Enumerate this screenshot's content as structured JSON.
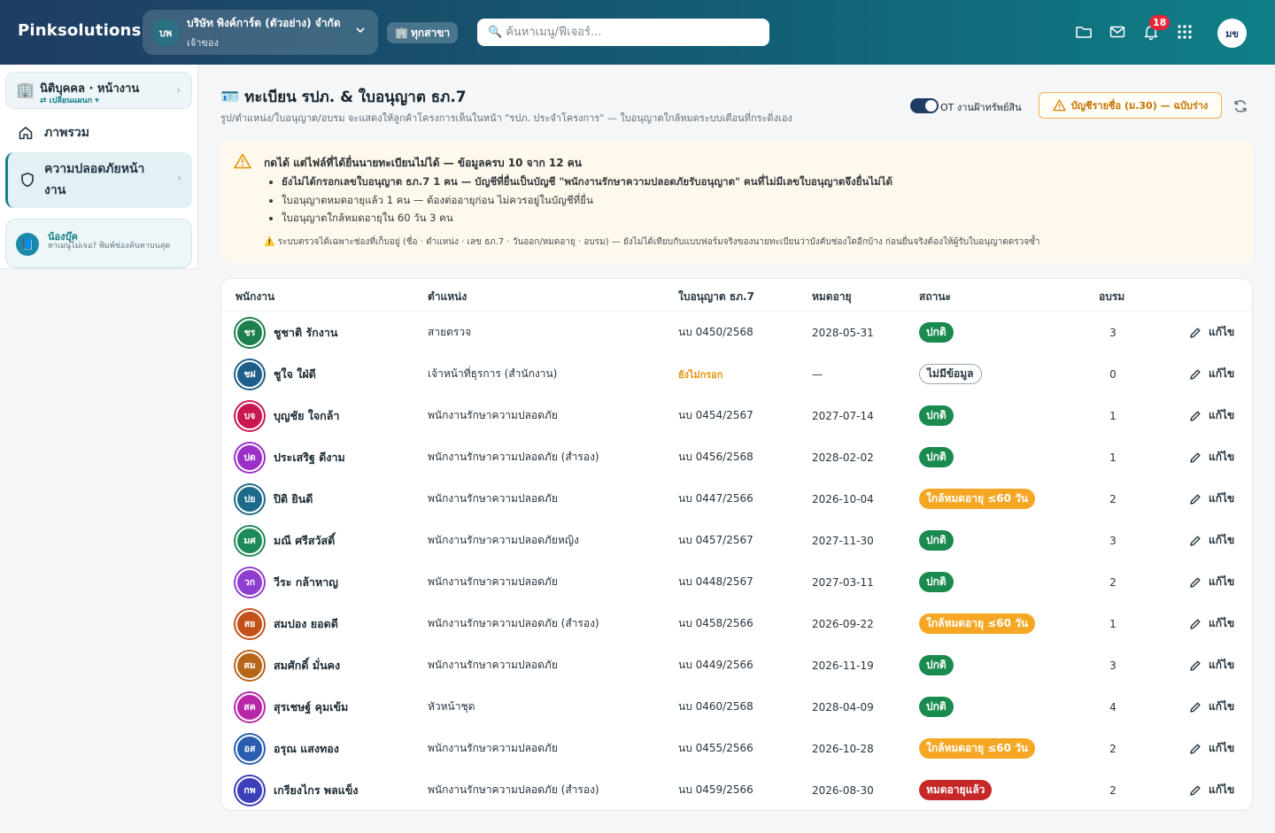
{
  "topbar": {
    "brand": "Pinksolutions",
    "company_initials": "บพ",
    "company_name": "บริษัท พิงค์การ์ด (ตัวอย่าง) จำกัด",
    "company_role": "เจ้าของ",
    "branch_label": "ทุกสาขา",
    "search_placeholder": "ค้นหาเมนู/ฟีเจอร์...",
    "notification_count": "18",
    "user_initials": "มข"
  },
  "sidebar": {
    "entity_title": "นิติบุคคล · หน้างาน",
    "entity_switch": "⇄ เปลี่ยนแผนก ▾",
    "home_label": "ภาพรวม",
    "active_label": "ความปลอดภัยหน้างาน",
    "help_title": "น้องบุ๊ค",
    "help_text": "หาเมนูไม่เจอ? พิมพ์ช่องค้นหาบนสุด"
  },
  "page": {
    "title": "ทะเบียน รปภ. & ใบอนุญาต ธภ.7",
    "subtitle": "รูป/ตำแหน่ง/ใบอนุญาต/อบรม จะแสดงให้ลูกค้าโครงการเห็นในหน้า \"รปภ. ประจำโครงการ\" — ใบอนุญาตใกล้หมดระบบเตือนที่กระดิ่งเอง",
    "toggle_label": "OT งานฝ้าทรัพย์สิน",
    "toggle_on": true,
    "draft_button": "บัญชีรายชื่อ (ม.30) — ฉบับร่าง"
  },
  "warning": {
    "title": "กดได้ แต่ไฟล์ที่ได้ยื่นนายทะเบียนไม่ได้ — ข้อมูลครบ 10 จาก 12 คน",
    "items": [
      "ยังไม่ได้กรอกเลขใบอนุญาต ธภ.7 1 คน — บัญชีที่ยื่นเป็นบัญชี \"พนักงานรักษาความปลอดภัยรับอนุญาต\" คนที่ไม่มีเลขใบอนุญาตจึงยื่นไม่ได้",
      "ใบอนุญาตหมดอายุแล้ว 1 คน — ต้องต่ออายุก่อน ไม่ควรอยู่ในบัญชีที่ยื่น",
      "ใบอนุญาตใกล้หมดอายุใน 60 วัน 3 คน"
    ],
    "note": "⚠️ ระบบตรวจได้เฉพาะช่องที่เก็บอยู่ (ชื่อ · ตำแหน่ง · เลข ธภ.7 · วันออก/หมดอายุ · อบรม) — ยังไม่ได้เทียบกับแบบฟอร์มจริงของนายทะเบียนว่าบังคับช่องใดอีกบ้าง ก่อนยื่นจริงต้องให้ผู้รับใบอนุญาตตรวจซ้ำ"
  },
  "table": {
    "headers": {
      "employee": "พนักงาน",
      "position": "ตำแหน่ง",
      "license": "ใบอนุญาต ธภ.7",
      "expiry": "หมดอายุ",
      "status": "สถานะ",
      "training": "อบรม"
    },
    "edit_label": "แก้ไข",
    "rows": [
      {
        "initials": "ชร",
        "name": "ชูชาติ รักงาน",
        "position": "สายตรวจ",
        "license": "นบ 0450/2568",
        "expiry": "2028-05-31",
        "status": "ปกติ",
        "status_type": "ok",
        "training": "3",
        "color": "#1d7f4e",
        "ring": "#1d7f4e"
      },
      {
        "initials": "ชฝ",
        "name": "ชูใจ ใฝ่ดี",
        "position": "เจ้าหน้าที่ธุรการ (สำนักงาน)",
        "license": "ยังไม่กรอก",
        "license_missing": true,
        "expiry": "—",
        "status": "ไม่มีข้อมูล",
        "status_type": "none",
        "training": "0",
        "color": "#1d5f88",
        "ring": "#1d5f88"
      },
      {
        "initials": "บจ",
        "name": "บุญชัย ใจกล้า",
        "position": "พนักงานรักษาความปลอดภัย",
        "license": "นบ 0454/2567",
        "expiry": "2027-07-14",
        "status": "ปกติ",
        "status_type": "ok",
        "training": "1",
        "color": "#c9174f",
        "ring": "#c9174f"
      },
      {
        "initials": "ปด",
        "name": "ประเสริฐ ดีงาม",
        "position": "พนักงานรักษาความปลอดภัย (สำรอง)",
        "license": "นบ 0456/2568",
        "expiry": "2028-02-02",
        "status": "ปกติ",
        "status_type": "ok",
        "training": "1",
        "color": "#9b30c9",
        "ring": "#9b30c9"
      },
      {
        "initials": "ปย",
        "name": "ปิติ ยินดี",
        "position": "พนักงานรักษาความปลอดภัย",
        "license": "นบ 0447/2566",
        "expiry": "2026-10-04",
        "status": "ใกล้หมดอายุ ≤60 วัน",
        "status_type": "soon",
        "training": "2",
        "color": "#1d6a8a",
        "ring": "#1d6a8a"
      },
      {
        "initials": "มศ",
        "name": "มณี ศรีสวัสดิ์",
        "position": "พนักงานรักษาความปลอดภัยหญิง",
        "license": "นบ 0457/2567",
        "expiry": "2027-11-30",
        "status": "ปกติ",
        "status_type": "ok",
        "training": "3",
        "color": "#1e8a5a",
        "ring": "#1e8a5a"
      },
      {
        "initials": "วก",
        "name": "วีระ กล้าหาญ",
        "position": "พนักงานรักษาความปลอดภัย",
        "license": "นบ 0448/2567",
        "expiry": "2027-03-11",
        "status": "ปกติ",
        "status_type": "ok",
        "training": "2",
        "color": "#8f3ed1",
        "ring": "#8f3ed1"
      },
      {
        "initials": "สย",
        "name": "สมปอง ยอดดี",
        "position": "พนักงานรักษาความปลอดภัย (สำรอง)",
        "license": "นบ 0458/2566",
        "expiry": "2026-09-22",
        "status": "ใกล้หมดอายุ ≤60 วัน",
        "status_type": "soon",
        "training": "1",
        "color": "#c4501a",
        "ring": "#c4501a"
      },
      {
        "initials": "สม",
        "name": "สมศักดิ์ มั่นคง",
        "position": "พนักงานรักษาความปลอดภัย",
        "license": "นบ 0449/2566",
        "expiry": "2026-11-19",
        "status": "ปกติ",
        "status_type": "ok",
        "training": "3",
        "color": "#b8661a",
        "ring": "#b8661a"
      },
      {
        "initials": "สค",
        "name": "สุรเชษฐ์ คุมเข้ม",
        "position": "หัวหน้าชุด",
        "license": "นบ 0460/2568",
        "expiry": "2028-04-09",
        "status": "ปกติ",
        "status_type": "ok",
        "training": "4",
        "color": "#b827a8",
        "ring": "#b827a8"
      },
      {
        "initials": "อส",
        "name": "อรุณ แสงทอง",
        "position": "พนักงานรักษาความปลอดภัย",
        "license": "นบ 0455/2566",
        "expiry": "2026-10-28",
        "status": "ใกล้หมดอายุ ≤60 วัน",
        "status_type": "soon",
        "training": "2",
        "color": "#2a5db0",
        "ring": "#2a5db0"
      },
      {
        "initials": "กพ",
        "name": "เกรียงไกร พลแข็ง",
        "position": "พนักงานรักษาความปลอดภัย (สำรอง)",
        "license": "นบ 0459/2566",
        "expiry": "2026-08-30",
        "status": "หมดอายุแล้ว",
        "status_type": "exp",
        "training": "2",
        "color": "#3b3fb8",
        "ring": "#3b3fb8"
      }
    ]
  }
}
